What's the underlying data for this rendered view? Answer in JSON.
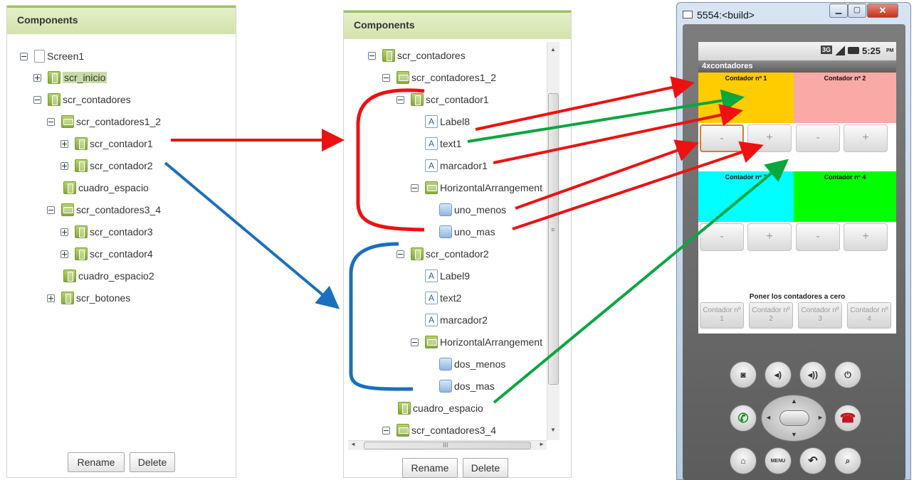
{
  "panel1": {
    "title": "Components",
    "rename": "Rename",
    "delete": "Delete",
    "nodes": [
      "Screen1",
      "scr_inicio",
      "scr_contadores",
      "scr_contadores1_2",
      "scr_contador1",
      "scr_contador2",
      "cuadro_espacio",
      "scr_contadores3_4",
      "scr_contador3",
      "scr_contador4",
      "cuadro_espacio2",
      "scr_botones"
    ]
  },
  "panel2": {
    "title": "Components",
    "rename": "Rename",
    "delete": "Delete",
    "scroll_mid": "≡",
    "hscroll_grip": "III",
    "nodes": [
      "scr_contadores",
      "scr_contadores1_2",
      "scr_contador1",
      "Label8",
      "text1",
      "marcador1",
      "HorizontalArrangement",
      "uno_menos",
      "uno_mas",
      "scr_contador2",
      "Label9",
      "text2",
      "marcador2",
      "HorizontalArrangement",
      "dos_menos",
      "dos_mas",
      "cuadro_espacio",
      "scr_contadores3_4"
    ]
  },
  "emulator": {
    "window_title": "5554:<build>",
    "status_time": "5:25",
    "status_ampm": "PM",
    "network": "3G",
    "app_title": "4xcontadores",
    "counters": [
      "Contador nº 1",
      "Contador nº 2",
      "Contador nº 3",
      "Contador nº 4"
    ],
    "minus": "-",
    "plus": "+",
    "reset_label": "Poner los contadores a cero",
    "reset_buttons": [
      "Contador nº 1",
      "Contador nº 2",
      "Contador nº 3",
      "Contador nº 4"
    ],
    "menu_key": "MENU",
    "colors": {
      "c1": "#ffcc00",
      "c2": "#f9a9a6",
      "c3": "#00ffff",
      "c4": "#00ff00"
    }
  },
  "arrow_colors": {
    "red": "#ee1111",
    "green": "#0aa640",
    "blue": "#1a6fbf"
  }
}
